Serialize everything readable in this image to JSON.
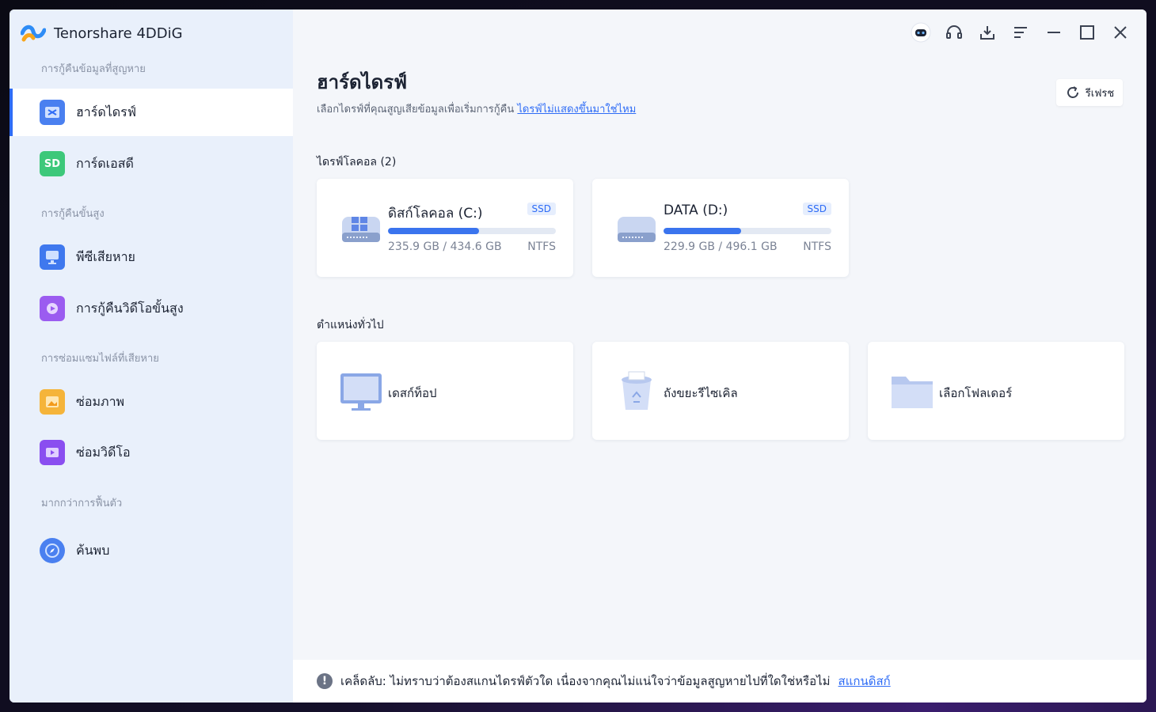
{
  "app": {
    "name": "Tenorshare 4DDiG"
  },
  "colors": {
    "accent": "#2e6cf6",
    "sidebar_bg": "#e9f0fb",
    "bar_fill": "#3a74ee"
  },
  "sidebar": {
    "sections": [
      {
        "label": "การกู้คืนข้อมูลที่สูญหาย"
      },
      {
        "label": "การกู้คืนขั้นสูง"
      },
      {
        "label": "การซ่อมแซมไฟล์ที่เสียหาย"
      },
      {
        "label": "มากกว่าการฟื้นตัว"
      }
    ],
    "items": [
      {
        "label": "ฮาร์ดไดรฟ์",
        "icon": "hard-drive-icon",
        "active": true
      },
      {
        "label": "การ์ดเอสดี",
        "icon": "sd-card-icon"
      },
      {
        "label": "พีซีเสียหาย",
        "icon": "crashed-pc-icon"
      },
      {
        "label": "การกู้คืนวิดีโอขั้นสูง",
        "icon": "video-recovery-icon"
      },
      {
        "label": "ซ่อมภาพ",
        "icon": "photo-repair-icon"
      },
      {
        "label": "ซ่อมวิดีโอ",
        "icon": "video-repair-icon"
      },
      {
        "label": "ค้นพบ",
        "icon": "compass-icon"
      }
    ]
  },
  "header": {
    "title": "ฮาร์ดไดรฟ์",
    "subtitle": "เลือกไดรฟ์ที่คุณสูญเสียข้อมูลเพื่อเริ่มการกู้คืน",
    "subtitle_link": "ไดรฟ์ไม่แสดงขึ้นมาใช่ไหม",
    "refresh_label": "รีเฟรช"
  },
  "local_drives": {
    "label": "ไดรฟ์โลคอล (2)",
    "drives": [
      {
        "name": "ดิสก์โลคอล (C:)",
        "badge": "SSD",
        "size": "235.9 GB / 434.6 GB",
        "fs": "NTFS",
        "used_fraction": 0.543
      },
      {
        "name": "DATA (D:)",
        "badge": "SSD",
        "size": "229.9 GB / 496.1 GB",
        "fs": "NTFS",
        "used_fraction": 0.463
      }
    ]
  },
  "common_locations": {
    "label": "ตำแหน่งทั่วไป",
    "items": [
      {
        "name": "เดสก์ท็อป",
        "icon": "desktop-icon"
      },
      {
        "name": "ถังขยะรีไซเคิล",
        "icon": "recycle-bin-icon"
      },
      {
        "name": "เลือกโฟลเดอร์",
        "icon": "folder-icon"
      }
    ]
  },
  "tip": {
    "text": "เคล็ดลับ: ไม่ทราบว่าต้องสแกนไดรฟ์ตัวใด เนื่องจากคุณไม่แน่ใจว่าข้อมูลสูญหายไปที่ใดใช่หรือไม่",
    "link": "สแกนดิสก์"
  }
}
